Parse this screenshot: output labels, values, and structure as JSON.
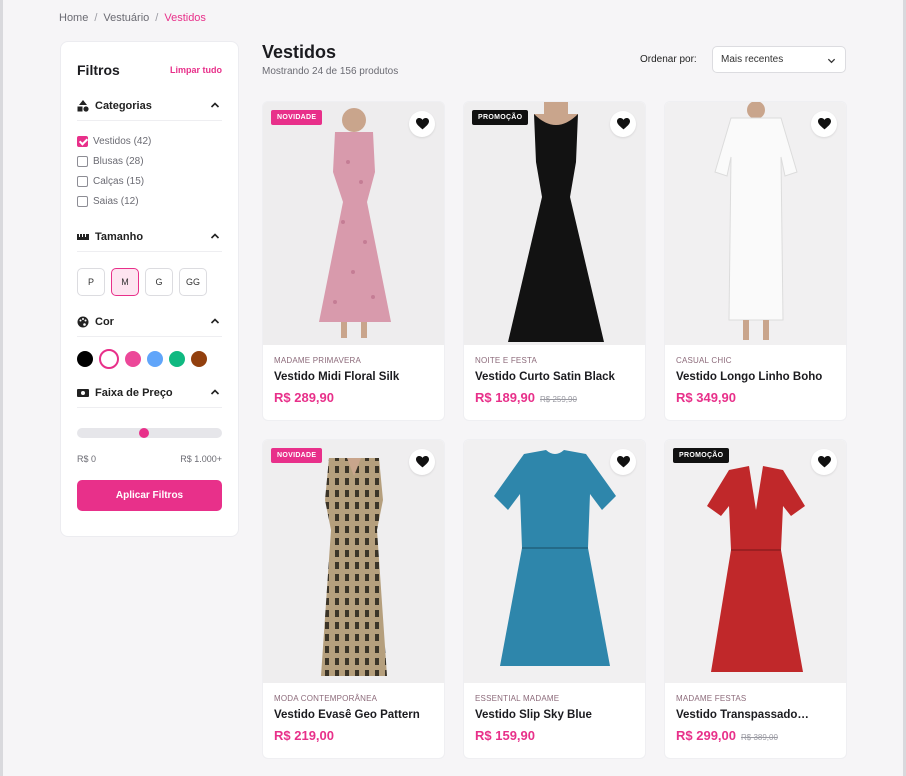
{
  "breadcrumb": {
    "home": "Home",
    "section": "Vestuário",
    "current": "Vestidos"
  },
  "filters": {
    "title": "Filtros",
    "clear": "Limpar tudo",
    "categories_title": "Categorias",
    "categories": [
      {
        "label": "Vestidos (42)",
        "checked": true
      },
      {
        "label": "Blusas (28)",
        "checked": false
      },
      {
        "label": "Calças (15)",
        "checked": false
      },
      {
        "label": "Saias (12)",
        "checked": false
      }
    ],
    "size_title": "Tamanho",
    "sizes": [
      "P",
      "M",
      "G",
      "GG"
    ],
    "selected_size": "M",
    "color_title": "Cor",
    "colors": [
      "#000000",
      "#ffffff",
      "#ec4899",
      "#60a5fa",
      "#10b981",
      "#92400e"
    ],
    "selected_color": "#ffffff",
    "price_title": "Faixa de Preço",
    "price_min": "R$ 0",
    "price_max": "R$ 1.000+",
    "slider_value_fraction": 0.46,
    "apply": "Aplicar Filtros"
  },
  "main": {
    "title": "Vestidos",
    "subtitle": "Mostrando 24 de 156 produtos",
    "sort_label": "Ordenar por:",
    "sort_value": "Mais recentes"
  },
  "products": [
    {
      "badge": "NOVIDADE",
      "badge_type": "new",
      "brand": "MADAME PRIMAVERA",
      "name": "Vestido Midi Floral Silk",
      "price": "R$ 289,90",
      "old_price": ""
    },
    {
      "badge": "PROMOÇÃO",
      "badge_type": "promo",
      "brand": "NOITE E FESTA",
      "name": "Vestido Curto Satin Black",
      "price": "R$ 189,90",
      "old_price": "R$ 259,90"
    },
    {
      "badge": "",
      "badge_type": "",
      "brand": "CASUAL CHIC",
      "name": "Vestido Longo Linho Boho",
      "price": "R$ 349,90",
      "old_price": ""
    },
    {
      "badge": "NOVIDADE",
      "badge_type": "new",
      "brand": "MODA CONTEMPORÂNEA",
      "name": "Vestido Evasê Geo Pattern",
      "price": "R$ 219,00",
      "old_price": ""
    },
    {
      "badge": "",
      "badge_type": "",
      "brand": "ESSENTIAL MADAME",
      "name": "Vestido Slip Sky Blue",
      "price": "R$ 159,90",
      "old_price": ""
    },
    {
      "badge": "PROMOÇÃO",
      "badge_type": "promo",
      "brand": "MADAME FESTAS",
      "name": "Vestido Transpassado…",
      "price": "R$ 299,00",
      "old_price": "R$ 389,00"
    }
  ],
  "colors": {
    "accent": "#e8308a"
  }
}
